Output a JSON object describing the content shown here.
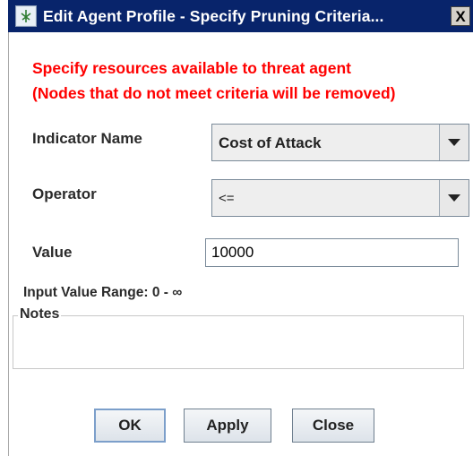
{
  "window": {
    "title": "Edit Agent Profile - Specify Pruning Criteria...",
    "close_glyph": "X",
    "icon": "app-icon"
  },
  "instructions": {
    "line1": "Specify resources available to threat agent",
    "line2": "(Nodes that do not meet criteria will be removed)",
    "color": "#ff0000"
  },
  "form": {
    "indicator_label": "Indicator Name",
    "indicator_value": "Cost of Attack",
    "operator_label": "Operator",
    "operator_value": "<=",
    "value_label": "Value",
    "value_input": "10000",
    "range_text": "Input Value Range: 0 - ∞"
  },
  "notes": {
    "legend": "Notes",
    "text": ""
  },
  "buttons": {
    "ok": "OK",
    "apply": "Apply",
    "close": "Close"
  },
  "colors": {
    "titlebar": "#08246b",
    "title_text": "#ffffff"
  }
}
